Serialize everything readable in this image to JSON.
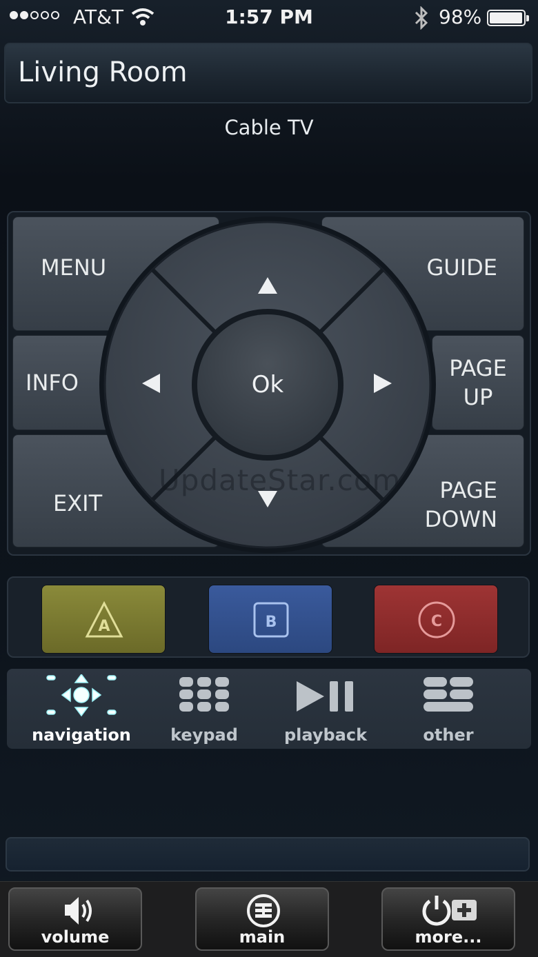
{
  "status": {
    "carrier": "AT&T",
    "time": "1:57 PM",
    "battery": "98%",
    "battery_level": 0.98
  },
  "header": {
    "room": "Living Room",
    "device": "Cable TV"
  },
  "dpad": {
    "menu": "MENU",
    "guide": "GUIDE",
    "info": "INFO",
    "page_up_1": "PAGE",
    "page_up_2": "UP",
    "exit": "EXIT",
    "page_down_1": "PAGE",
    "page_down_2": "DOWN",
    "ok": "Ok"
  },
  "watermark": "UpdateStar.com",
  "color_buttons": [
    {
      "letter": "A",
      "color": "#7d7c32"
    },
    {
      "letter": "B",
      "color": "#34539a"
    },
    {
      "letter": "C",
      "color": "#8e2d2d"
    }
  ],
  "modes": [
    {
      "label": "navigation",
      "active": true
    },
    {
      "label": "keypad",
      "active": false
    },
    {
      "label": "playback",
      "active": false
    },
    {
      "label": "other",
      "active": false
    }
  ],
  "bottom": {
    "volume": "volume",
    "main": "main",
    "more": "more..."
  }
}
